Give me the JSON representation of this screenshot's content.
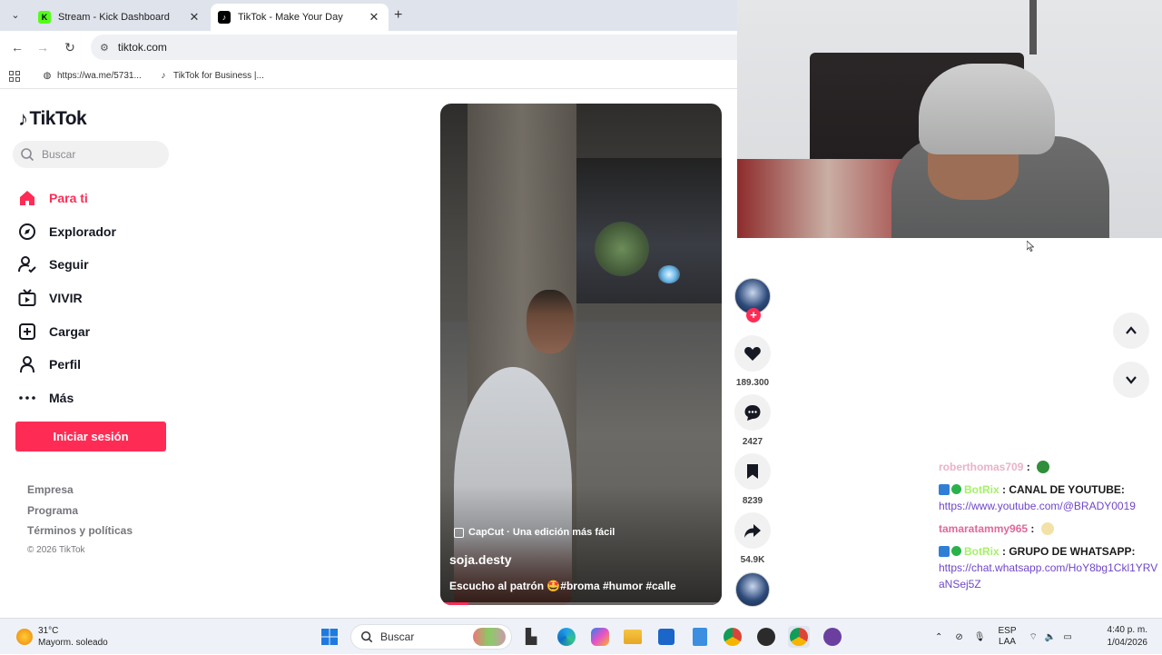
{
  "browser": {
    "tabs": [
      {
        "title": "Stream - Kick Dashboard",
        "favicon": "kick-icon",
        "active": false
      },
      {
        "title": "TikTok - Make Your Day",
        "favicon": "tiktok-icon",
        "active": true
      }
    ],
    "url": "tiktok.com",
    "bookmarks": [
      "https://wa.me/5731...",
      "TikTok for Business |..."
    ]
  },
  "sidebar": {
    "logo": "TikTok",
    "search_placeholder": "Buscar",
    "menu": [
      {
        "label": "Para ti",
        "icon": "home-icon",
        "active": true
      },
      {
        "label": "Explorador",
        "icon": "compass-icon",
        "active": false
      },
      {
        "label": "Seguir",
        "icon": "follow-icon",
        "active": false
      },
      {
        "label": "VIVIR",
        "icon": "live-icon",
        "active": false
      },
      {
        "label": "Cargar",
        "icon": "upload-icon",
        "active": false
      },
      {
        "label": "Perfil",
        "icon": "profile-icon",
        "active": false
      },
      {
        "label": "Más",
        "icon": "more-icon",
        "active": false
      }
    ],
    "login_button": "Iniciar sesión",
    "footer": [
      "Empresa",
      "Programa",
      "Términos y políticas"
    ],
    "copyright": "© 2026 TikTok"
  },
  "video": {
    "capcut": "CapCut · Una edición más fácil",
    "username": "soja.desty",
    "description": "Escucho al patrón 🤩#broma #humor #calle",
    "progress": 0.1
  },
  "actions": {
    "likes": "189.300",
    "comments": "2427",
    "saves": "8239",
    "shares": "54.9K"
  },
  "chat": [
    {
      "user": "roberthomas709",
      "sep": " : ",
      "text": "",
      "url": "",
      "emote": true
    },
    {
      "user": "BotRix",
      "sep": " : ",
      "text": "CANAL DE YOUTUBE:",
      "url": "https://www.youtube.com/@BRADY0019",
      "emote": false
    },
    {
      "user": "tamaratammy965",
      "sep": " : ",
      "text": "",
      "url": "",
      "emote": true
    },
    {
      "user": "BotRix",
      "sep": " : ",
      "text": "GRUPO DE WHATSAPP:",
      "url": "https://chat.whatsapp.com/HoY8bg1Ckl1YRVaNSej5Z",
      "emote": false
    }
  ],
  "taskbar": {
    "temp": "31°C",
    "weather": "Mayorm. soleado",
    "search": "Buscar",
    "lang1": "ESP",
    "lang2": "LAA",
    "time": "4:40 p. m.",
    "date": "1/04/2026"
  },
  "colors": {
    "accent": "#fe2c55",
    "bot": "#a6f06a",
    "link": "#6f46c9"
  }
}
